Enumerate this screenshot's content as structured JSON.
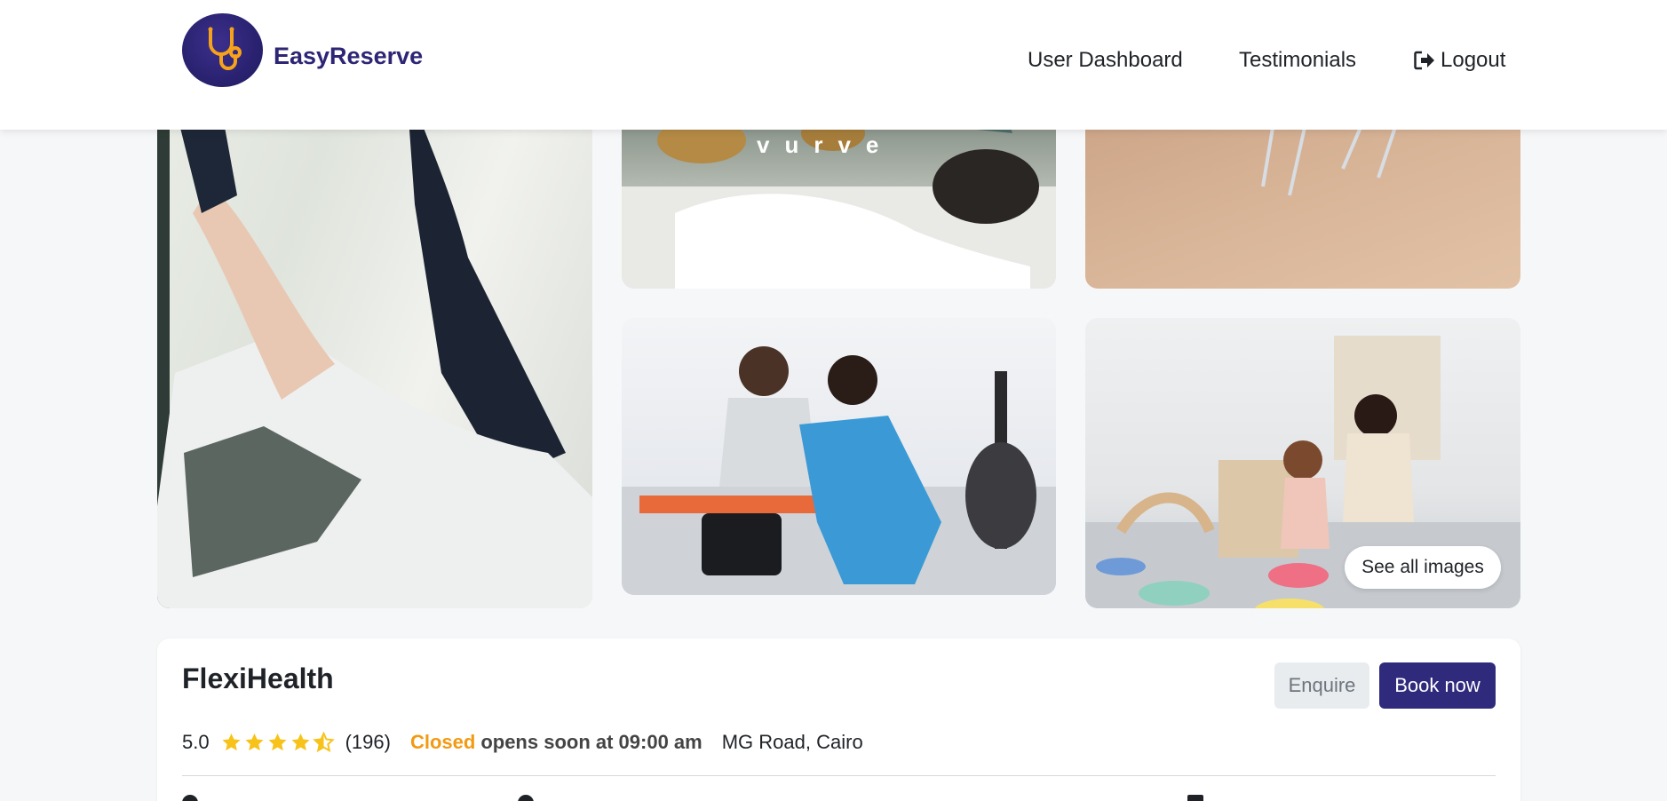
{
  "header": {
    "brand": "EasyReserve",
    "nav": {
      "dashboard": "User Dashboard",
      "testimonials": "Testimonials",
      "logout": "Logout"
    }
  },
  "gallery": {
    "overlay_text": "vurve",
    "see_all_label": "See all images"
  },
  "clinic": {
    "name": "FlexiHealth",
    "rating": "5.0",
    "stars_filled": 4.5,
    "review_count": "(196)",
    "status": "Closed",
    "opens_text": "opens soon at 09:00 am",
    "location": "MG Road, Cairo",
    "enquire_label": "Enquire",
    "book_label": "Book now"
  },
  "colors": {
    "brand": "#2d2575",
    "primary_button": "#2f2a7c",
    "closed_status": "#f29a12",
    "star": "#f7c31a"
  },
  "icons": [
    "stethoscope-icon",
    "logout-icon",
    "star-icon"
  ]
}
